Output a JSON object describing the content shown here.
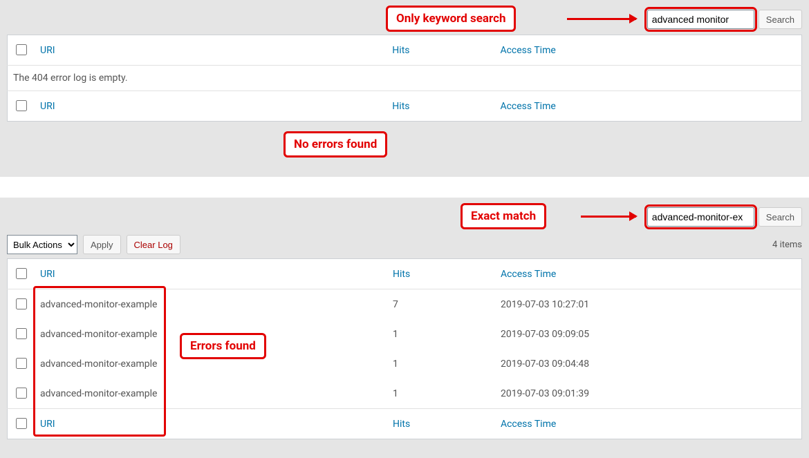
{
  "panel1": {
    "search_value": "advanced monitor",
    "search_button": "Search",
    "callout_keyword": "Only keyword search",
    "callout_noerrors": "No errors found",
    "columns": {
      "uri": "URI",
      "hits": "Hits",
      "access": "Access Time"
    },
    "empty_msg": "The 404 error log is empty."
  },
  "panel2": {
    "search_value": "advanced-monitor-ex",
    "search_button": "Search",
    "callout_exact": "Exact match",
    "callout_errors": "Errors found",
    "bulk_label": "Bulk Actions",
    "apply_label": "Apply",
    "clear_label": "Clear Log",
    "items_count": "4 items",
    "columns": {
      "uri": "URI",
      "hits": "Hits",
      "access": "Access Time"
    },
    "rows": [
      {
        "uri": "advanced-monitor-example",
        "hits": "7",
        "access": "2019-07-03 10:27:01"
      },
      {
        "uri": "advanced-monitor-example",
        "hits": "1",
        "access": "2019-07-03 09:09:05"
      },
      {
        "uri": "advanced-monitor-example",
        "hits": "1",
        "access": "2019-07-03 09:04:48"
      },
      {
        "uri": "advanced-monitor-example",
        "hits": "1",
        "access": "2019-07-03 09:01:39"
      }
    ]
  }
}
